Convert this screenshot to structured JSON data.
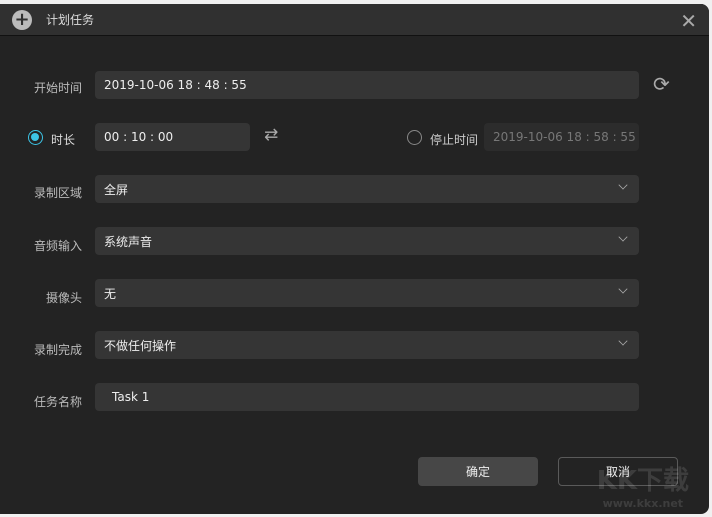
{
  "title": "计划任务",
  "start_time": {
    "label": "开始时间",
    "value": "2019-10-06 18 : 48 : 55"
  },
  "duration": {
    "label": "时长",
    "value": "00 : 10 : 00",
    "selected": true
  },
  "stop_time": {
    "label": "停止时间",
    "value": "2019-10-06 18 : 58 : 55",
    "selected": false
  },
  "record_area": {
    "label": "录制区域",
    "value": "全屏"
  },
  "audio_input": {
    "label": "音频输入",
    "value": "系统声音"
  },
  "camera": {
    "label": "摄像头",
    "value": "无"
  },
  "on_complete": {
    "label": "录制完成",
    "value": "不做任何操作"
  },
  "task_name": {
    "label": "任务名称",
    "value": "Task 1"
  },
  "buttons": {
    "ok": "确定",
    "cancel": "取消"
  },
  "watermark": {
    "logo": "KK下载",
    "url": "www.kkx.net"
  },
  "accent": "#3cc4e6"
}
